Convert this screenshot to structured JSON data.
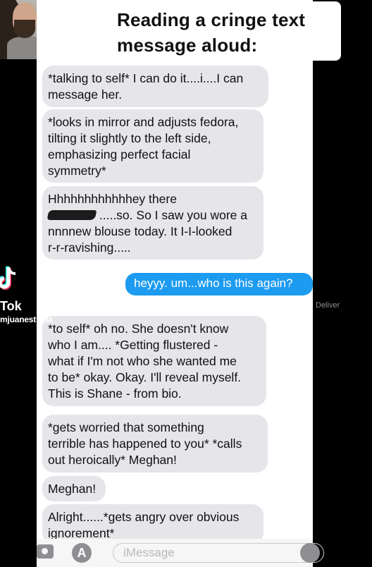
{
  "caption": {
    "line1": "Reading a cringe text",
    "line2": "message aloud:"
  },
  "messages": [
    {
      "type": "received",
      "lines": [
        "*talking to self* I can do it....i....I can",
        "message her."
      ]
    },
    {
      "type": "received",
      "lines": [
        "*looks in mirror and adjusts fedora,",
        "tilting it slightly to the left side,",
        "emphasizing perfect facial",
        "symmetry*"
      ]
    },
    {
      "type": "received",
      "lines": [
        "Hhhhhhhhhhhhey there",
        ".....so. So I saw you wore a",
        "nnnnew blouse today. It I-I-looked",
        "r-r-ravishing....."
      ]
    },
    {
      "type": "sent",
      "lines": [
        "heyyy. um...who is this again?"
      ]
    },
    {
      "type": "received",
      "lines": [
        "*to self* oh no. She doesn't know",
        "who I am.... *Getting flustered -",
        "what if I'm not who she wanted me",
        "to be* okay. Okay. I'll reveal myself.",
        "This is Shane - from bio."
      ]
    },
    {
      "type": "received",
      "lines": [
        "*gets worried that something",
        "terrible has happened to you* *calls",
        "out heroically* Meghan!"
      ]
    },
    {
      "type": "received",
      "lines": [
        "Meghan!"
      ]
    },
    {
      "type": "received",
      "lines": [
        "Alright......*gets angry over obvious",
        "ignorement*"
      ]
    }
  ],
  "delivered": "Deliver",
  "tiktok": {
    "wordmark": "Tok",
    "username": "mjuanestrella"
  },
  "composer": {
    "placeholder": "iMessage",
    "apps_glyph": "A"
  },
  "colors": {
    "sent_bubble": "#1d9bf0",
    "received_bubble": "#e5e5ea"
  },
  "icons": [
    "camera-icon",
    "app-store-icon",
    "microphone-icon",
    "tiktok-logo-icon"
  ]
}
